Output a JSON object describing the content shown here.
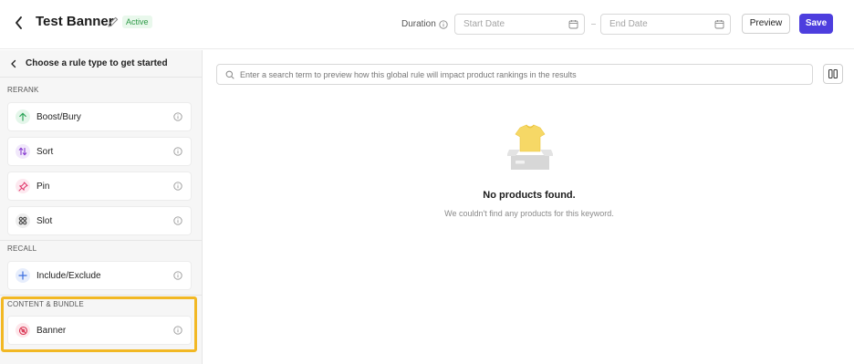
{
  "header": {
    "title": "Test Banner",
    "status": "Active",
    "duration_label": "Duration",
    "start_date_placeholder": "Start Date",
    "end_date_placeholder": "End Date",
    "preview_label": "Preview",
    "save_label": "Save"
  },
  "sidebar": {
    "heading": "Choose a rule type to get started",
    "sections": [
      {
        "label": "RERANK",
        "items": [
          {
            "label": "Boost/Bury",
            "icon": "arrow-up-icon",
            "color": "#2ea55a",
            "bg": "#e4f6ea"
          },
          {
            "label": "Sort",
            "icon": "sort-arrows-icon",
            "color": "#8a3fd1",
            "bg": "#f1e8fb"
          },
          {
            "label": "Pin",
            "icon": "pin-icon",
            "color": "#e0356a",
            "bg": "#fde8ef"
          },
          {
            "label": "Slot",
            "icon": "grid-slots-icon",
            "color": "#333333",
            "bg": "#eeeeee"
          }
        ]
      },
      {
        "label": "RECALL",
        "items": [
          {
            "label": "Include/Exclude",
            "icon": "plus-icon",
            "color": "#3b6ee0",
            "bg": "#e7eefc"
          }
        ]
      },
      {
        "label": "CONTENT & BUNDLE",
        "items": [
          {
            "label": "Banner",
            "icon": "banner-icon",
            "color": "#d9304f",
            "bg": "#fde6ea"
          }
        ]
      }
    ],
    "highlight_color": "#f2b824"
  },
  "main": {
    "search_placeholder": "Enter a search term to preview how this global rule will impact product rankings in the results",
    "empty_title": "No products found.",
    "empty_subtitle": "We couldn't find any products for this keyword."
  },
  "colors": {
    "accent": "#4d3ede",
    "active_badge": "#2e9a47"
  }
}
